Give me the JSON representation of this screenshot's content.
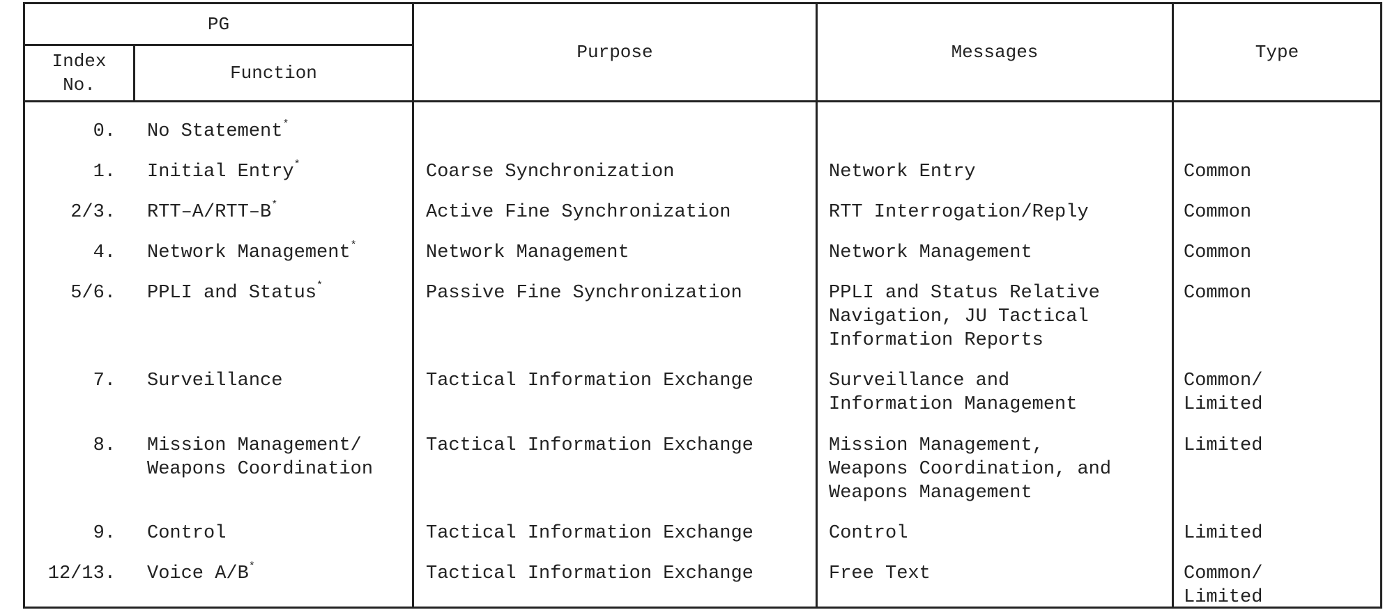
{
  "header": {
    "pg": "PG",
    "index_no": "Index\nNo.",
    "function": "Function",
    "purpose": "Purpose",
    "messages": "Messages",
    "type": "Type"
  },
  "rows": [
    {
      "index": "0.",
      "function": "No Statement",
      "asterisk": "*",
      "purpose": "",
      "messages": "",
      "type": ""
    },
    {
      "index": "1.",
      "function": "Initial Entry",
      "asterisk": "*",
      "purpose": "Coarse Synchronization",
      "messages": "Network Entry",
      "type": "Common"
    },
    {
      "index": "2/3.",
      "function": "RTT–A/RTT–B",
      "asterisk": "*",
      "purpose": "Active Fine Synchronization",
      "messages": "RTT Interrogation/Reply",
      "type": "Common"
    },
    {
      "index": "4.",
      "function": "Network Management",
      "asterisk": "*",
      "purpose": "Network Management",
      "messages": "Network Management",
      "type": "Common"
    },
    {
      "index": "5/6.",
      "function": "PPLI and Status",
      "asterisk": "*",
      "purpose": "Passive Fine Synchronization",
      "messages": "PPLI and Status Relative\nNavigation, JU Tactical\nInformation Reports",
      "type": "Common"
    },
    {
      "index": "7.",
      "function": "Surveillance",
      "asterisk": "",
      "purpose": "Tactical Information Exchange",
      "messages": "Surveillance and\nInformation Management",
      "type": "Common/\n  Limited"
    },
    {
      "index": "8.",
      "function": "Mission Management/\nWeapons Coordination",
      "asterisk": "",
      "purpose": "Tactical Information Exchange",
      "messages": "Mission Management,\nWeapons Coordination, and\nWeapons Management",
      "type": "Limited"
    },
    {
      "index": "9.",
      "function": "Control",
      "asterisk": "",
      "purpose": "Tactical Information Exchange",
      "messages": "Control",
      "type": "Limited"
    },
    {
      "index": "12/13.",
      "function": "Voice A/B",
      "asterisk": "*",
      "purpose": "Tactical Information Exchange",
      "messages": "Free Text",
      "type": "Common/\n  Limited"
    }
  ]
}
